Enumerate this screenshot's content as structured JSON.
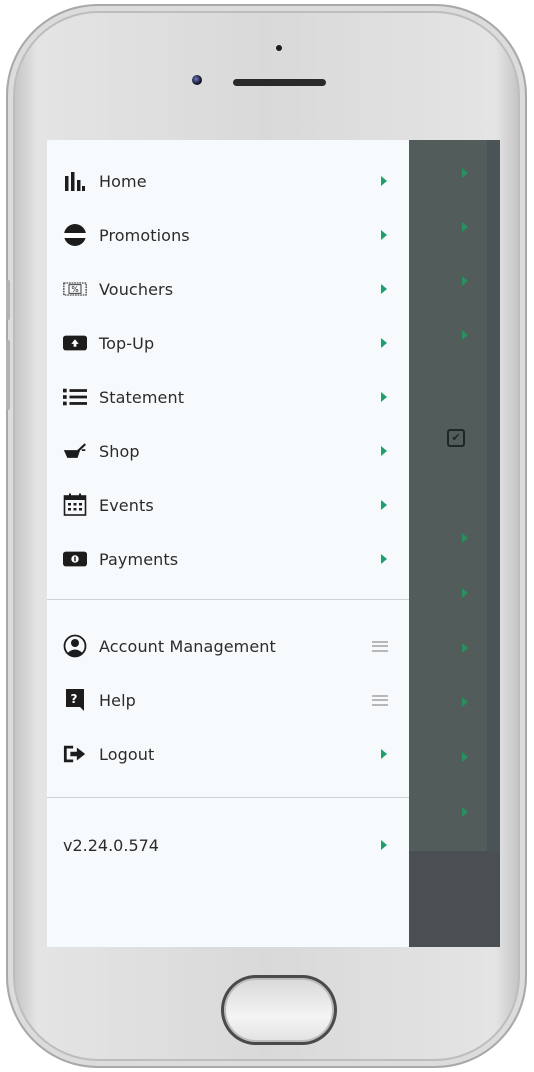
{
  "menu": {
    "items": [
      {
        "label": "Home",
        "icon": "bar-chart-icon"
      },
      {
        "label": "Promotions",
        "icon": "promo-badge-icon",
        "icon_text": "PROMO"
      },
      {
        "label": "Vouchers",
        "icon": "voucher-icon",
        "icon_text": "%"
      },
      {
        "label": "Top-Up",
        "icon": "top-up-icon"
      },
      {
        "label": "Statement",
        "icon": "list-icon"
      },
      {
        "label": "Shop",
        "icon": "shop-icon"
      },
      {
        "label": "Events",
        "icon": "calendar-icon"
      },
      {
        "label": "Payments",
        "icon": "payments-icon"
      }
    ],
    "secondary": [
      {
        "label": "Account Management",
        "icon": "user-icon"
      },
      {
        "label": "Help",
        "icon": "help-icon",
        "icon_text": "?"
      },
      {
        "label": "Logout",
        "icon": "logout-icon"
      }
    ],
    "version": "v2.24.0.574"
  },
  "colors": {
    "accent": "#1ea06a",
    "drawer_bg": "#f7fafc",
    "overlay_bg": "#525c5b"
  }
}
